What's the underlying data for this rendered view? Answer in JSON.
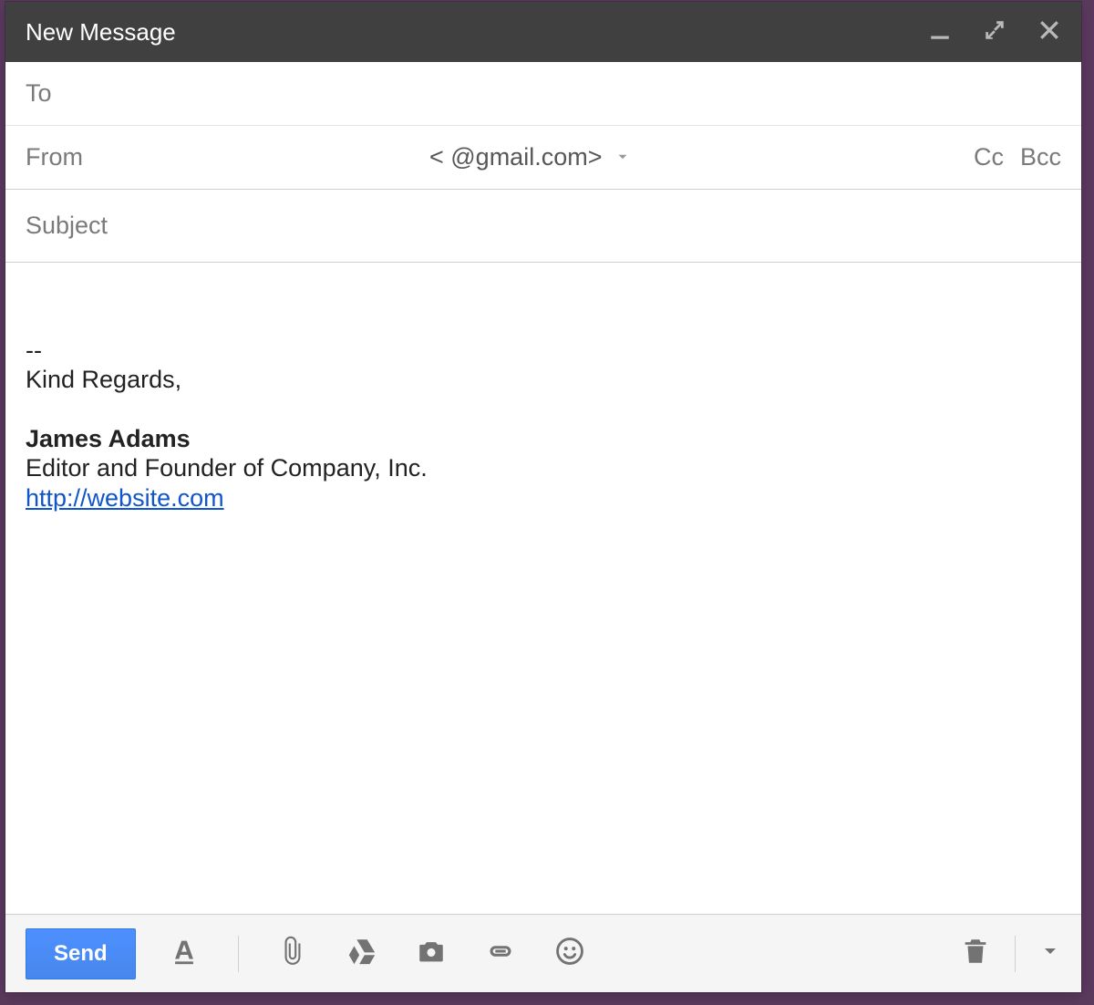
{
  "header": {
    "title": "New Message"
  },
  "fields": {
    "to_label": "To",
    "from_label": "From",
    "from_email": "<                         @gmail.com>",
    "cc_label": "Cc",
    "bcc_label": "Bcc",
    "subject_placeholder": "Subject"
  },
  "signature": {
    "separator": "--",
    "greeting": "Kind Regards,",
    "name": "James Adams",
    "title": "Editor and Founder of Company, Inc.",
    "link": "http://website.com"
  },
  "footer": {
    "send_label": "Send"
  }
}
